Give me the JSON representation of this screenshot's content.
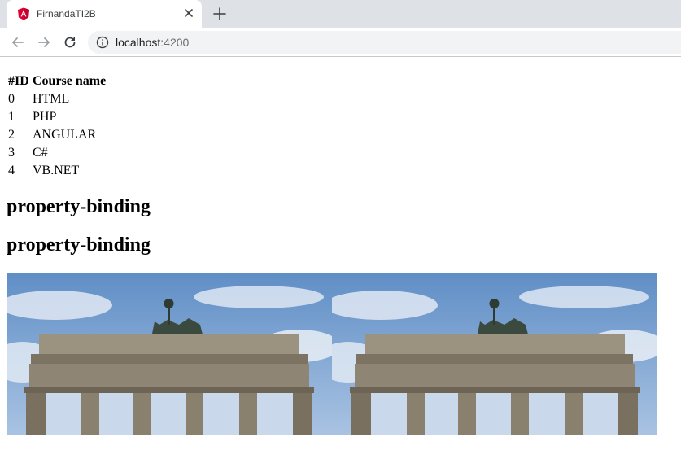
{
  "browser": {
    "tab_title": "FirnandaTI2B",
    "url_host": "localhost",
    "url_port": ":4200"
  },
  "table": {
    "headers": [
      "#ID",
      "Course name"
    ],
    "rows": [
      [
        "0",
        "HTML"
      ],
      [
        "1",
        "PHP"
      ],
      [
        "2",
        "ANGULAR"
      ],
      [
        "3",
        "C#"
      ],
      [
        "4",
        "VB.NET"
      ]
    ]
  },
  "headings": [
    "property-binding",
    "property-binding"
  ],
  "images": [
    {
      "subject": "brandenburg-gate-photo"
    },
    {
      "subject": "brandenburg-gate-photo"
    }
  ],
  "colors": {
    "tabstrip": "#dee1e6",
    "angular_red": "#dd0031",
    "sky": "#6d97c9"
  }
}
